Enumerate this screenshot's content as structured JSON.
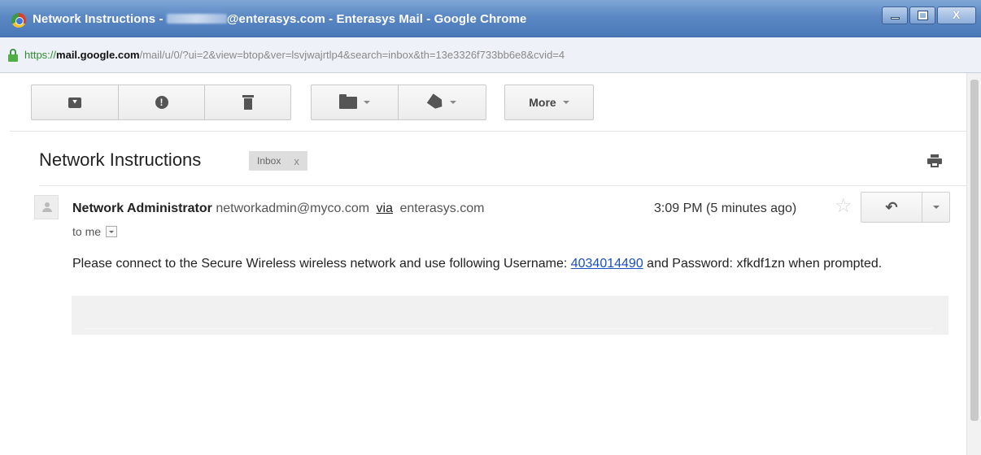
{
  "window": {
    "title_before": "Network Instructions - ",
    "title_after": "@enterasys.com - Enterasys Mail - Google Chrome",
    "controls": {
      "minimize": "minimize",
      "maximize": "maximize",
      "close": "X"
    }
  },
  "address_bar": {
    "scheme": "https://",
    "host": "mail.google.com",
    "path": "/mail/u/0/?ui=2&view=btop&ver=lsvjwajrtlp4&search=inbox&th=13e3326f733bb6e8&cvid=4"
  },
  "toolbar": {
    "archive_icon": "archive-icon",
    "spam_icon": "report-spam-icon",
    "spam_glyph": "!",
    "delete_icon": "trash-icon",
    "move_icon": "folder-icon",
    "labels_icon": "label-icon",
    "more_label": "More"
  },
  "message": {
    "subject": "Network Instructions",
    "label_chip": "Inbox",
    "label_chip_remove": "x",
    "sender_name": "Network Administrator",
    "sender_email": "networkadmin@myco.com",
    "via_text": "via",
    "via_domain": "enterasys.com",
    "to_text": "to me",
    "timestamp": "3:09 PM (5 minutes ago)",
    "star_glyph": "☆",
    "reply_glyph": "➦",
    "body_before": "Please connect to the Secure Wireless wireless network and use following Username: ",
    "username": "4034014490",
    "body_middle": " and Password: ",
    "password": "xfkdf1zn",
    "body_after": " when prompted."
  }
}
